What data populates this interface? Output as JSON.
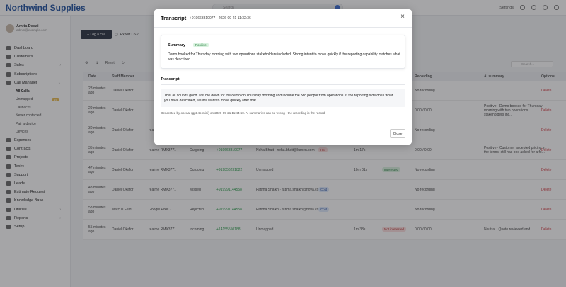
{
  "app": {
    "brand": "Northwind Supplies",
    "search_placeholder": "Search",
    "settings": "Settings"
  },
  "user": {
    "name": "Amita Desai",
    "email": "admin@example.com"
  },
  "nav": [
    {
      "label": "Dashboard"
    },
    {
      "label": "Customers"
    },
    {
      "label": "Sales",
      "chevron": "›"
    },
    {
      "label": "Subscriptions"
    },
    {
      "label": "Call Manager",
      "chevron": "⌄"
    }
  ],
  "call_sub": [
    {
      "label": "All Calls",
      "active": true
    },
    {
      "label": "Unmapped",
      "badge": "16"
    },
    {
      "label": "Callbacks"
    },
    {
      "label": "Never contacted"
    },
    {
      "label": "Pair a device"
    },
    {
      "label": "Devices"
    }
  ],
  "nav2": [
    {
      "label": "Expenses"
    },
    {
      "label": "Contracts"
    },
    {
      "label": "Projects"
    },
    {
      "label": "Tasks"
    },
    {
      "label": "Support"
    },
    {
      "label": "Leads"
    },
    {
      "label": "Estimate Request"
    },
    {
      "label": "Knowledge Base"
    },
    {
      "label": "Utilities",
      "chevron": "›"
    },
    {
      "label": "Reports",
      "chevron": "›"
    },
    {
      "label": "Setup"
    }
  ],
  "toolbar": {
    "log_call": "+ Log a call",
    "export": "Export CSV",
    "reset": "Reset",
    "table_search": "Search..."
  },
  "table": {
    "headers": [
      "Date",
      "Staff Member",
      "",
      "",
      "",
      "",
      "",
      "",
      "",
      "Recording",
      "AI summary",
      "Options"
    ],
    "rows": [
      {
        "date": "28 minutes ago",
        "staff": "Daniel Okafor",
        "ext": "",
        "dir": "",
        "from": "",
        "contact": "",
        "status": "",
        "dur": "",
        "out": "",
        "rec": "No recording",
        "ai": "",
        "opt": "Delete"
      },
      {
        "date": "29 minutes ago",
        "staff": "Daniel Okafor",
        "ext": "",
        "dir": "",
        "from": "",
        "contact": "",
        "status": "",
        "dur": "",
        "out": "",
        "rec": "0:00 / 0:00",
        "ai": "Positive · Demo booked for Thursday morning with two operations stakeholders inc...",
        "opt": "Delete"
      },
      {
        "date": "30 minutes ago",
        "staff": "Daniel Okafor",
        "ext": "realme RMX3771",
        "dir": "Incoming",
        "from": "+919887554321",
        "contact": "Unmapped",
        "status": "",
        "dur": "1m 58s",
        "out": "Interested",
        "rec": "No recording",
        "ai": "",
        "opt": "Delete"
      },
      {
        "date": "35 minutes ago",
        "staff": "Daniel Okafor",
        "ext": "realme RMX3771",
        "dir": "Outgoing",
        "from": "+919663310077",
        "contact": "Neha Bhatt · neha.bhatt@lumen.com",
        "status": "Hot",
        "dur": "1m 17s",
        "out": "",
        "rec": "0:00 / 0:00",
        "ai": "Positive · Customer accepted pricing in the terms; still has one asked for a fo...",
        "opt": "Delete"
      },
      {
        "date": "47 minutes ago",
        "staff": "Daniel Okafor",
        "ext": "realme RMX3771",
        "dir": "Outgoing",
        "from": "+919856231822",
        "contact": "Unmapped",
        "status": "",
        "dur": "10m 01s",
        "out": "Interested",
        "rec": "No recording",
        "ai": "",
        "opt": "Delete"
      },
      {
        "date": "48 minutes ago",
        "staff": "Daniel Okafor",
        "ext": "realme RMX3771",
        "dir": "Missed",
        "from": "+919991144558",
        "contact": "Fatima Shaikh · fatima.shaikh@nova.com",
        "status": "Cold",
        "dur": "",
        "out": "",
        "rec": "No recording",
        "ai": "",
        "opt": "Delete"
      },
      {
        "date": "53 minutes ago",
        "staff": "Marcus Feld",
        "ext": "Google Pixel 7",
        "dir": "Rejected",
        "from": "+919991144558",
        "contact": "Fatima Shaikh · fatima.shaikh@nova.com",
        "status": "Cold",
        "dur": "",
        "out": "",
        "rec": "No recording",
        "ai": "",
        "opt": "Delete"
      },
      {
        "date": "55 minutes ago",
        "staff": "Daniel Okafor",
        "ext": "realme RMX3771",
        "dir": "Incoming",
        "from": "+14155550188",
        "contact": "Unmapped",
        "status": "",
        "dur": "1m 38s",
        "out": "Not interested",
        "rec": "0:00 / 0:00",
        "ai": "Neutral · Quote reviewed and...",
        "opt": "Delete"
      }
    ]
  },
  "modal": {
    "title": "Transcript",
    "subtitle": "+919663310077 · 2026-09-21 11:32:36",
    "close": "×",
    "summary_label": "Summary",
    "summary_sentiment": "Positive",
    "summary_text": "Demo booked for Thursday morning with two operations stakeholders included. Strong intent to move quickly if the reporting capability matches what was described.",
    "transcript_label": "Transcript",
    "transcript_text": "That all sounds good. Put me down for the demo on Thursday morning and include the two people from operations. If the reporting side does what you have described, we will want to move quickly after that.",
    "generated": "Generated by openai (gpt-4o-mini) on 2026-09-21 11:44:50. AI summaries can be wrong - the recording is the record.",
    "close_button": "Close"
  }
}
